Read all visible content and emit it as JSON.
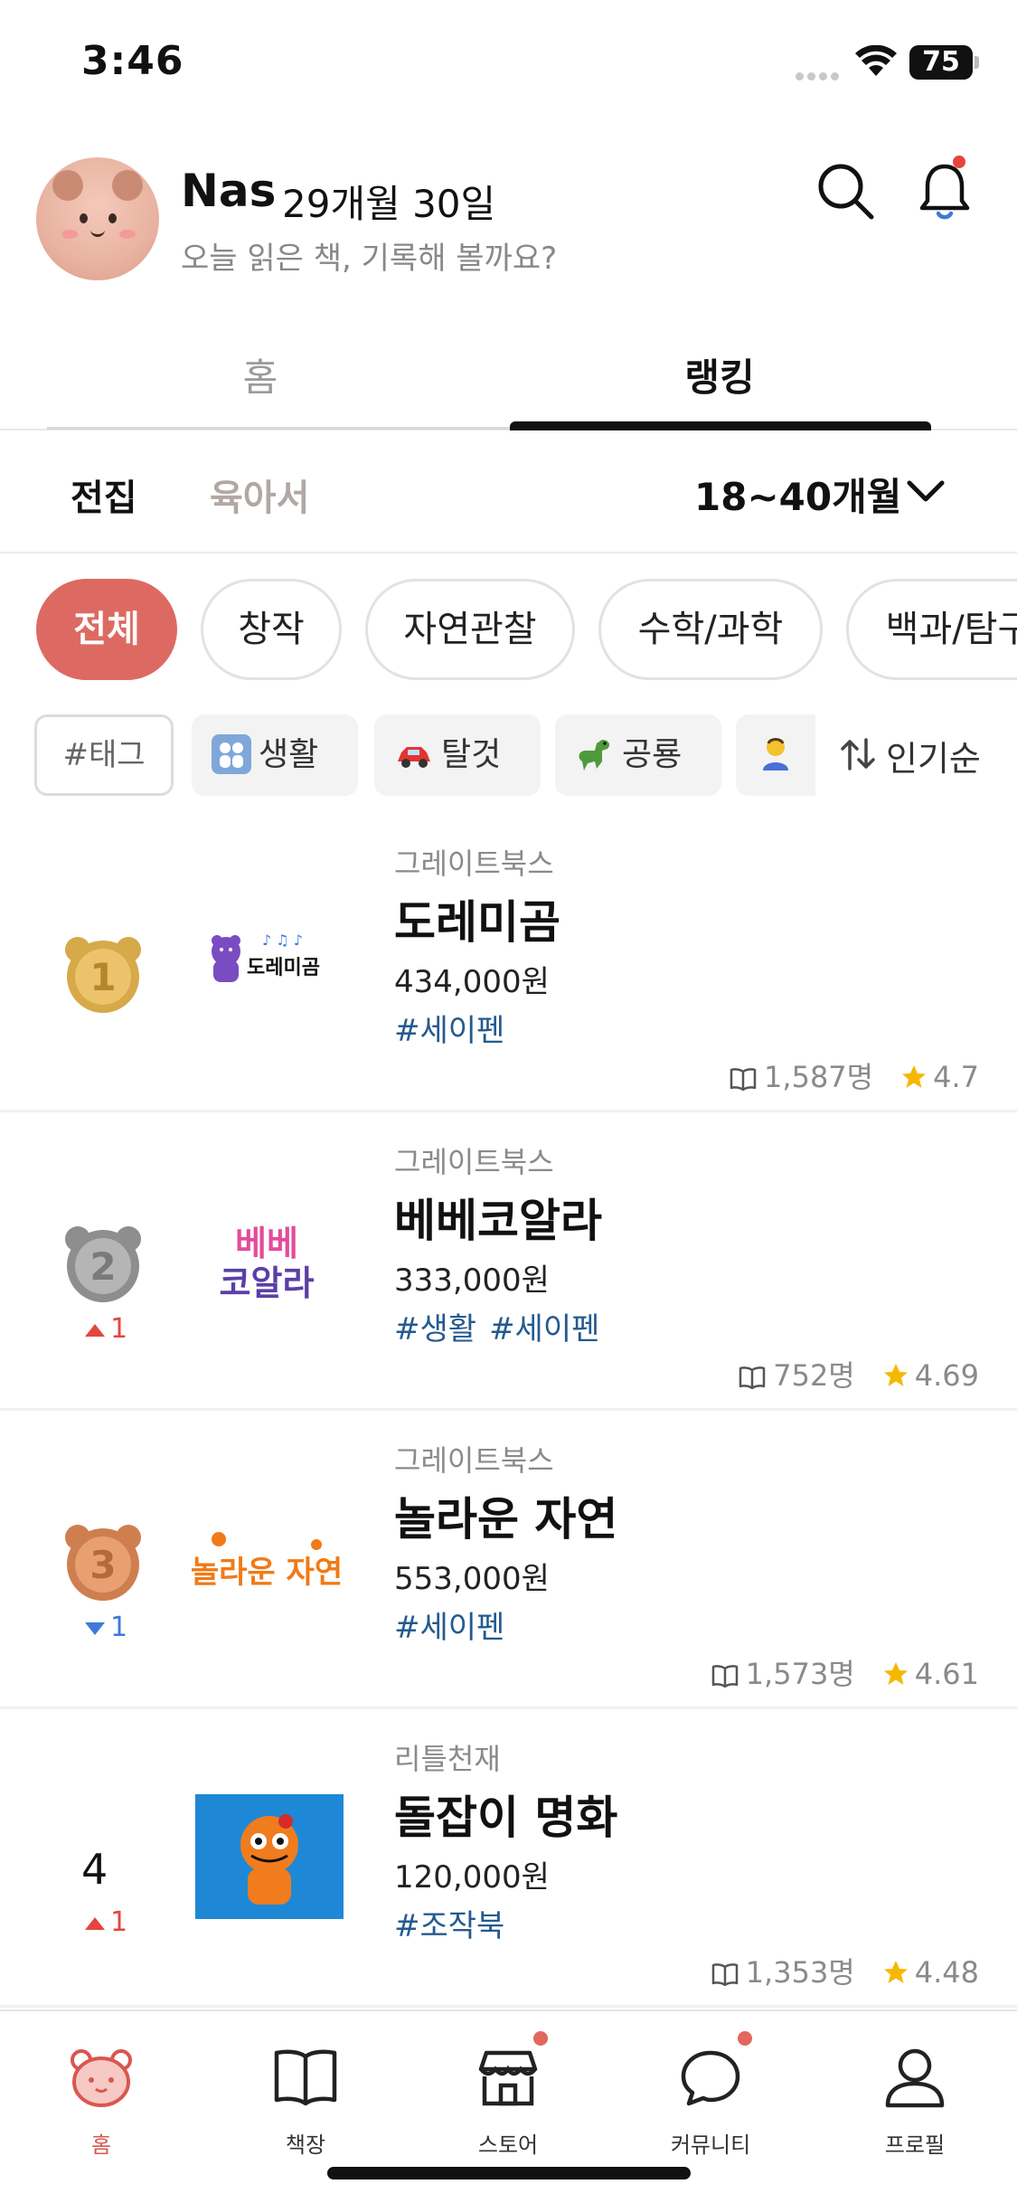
{
  "status_bar": {
    "time": "3:46",
    "battery": "75"
  },
  "header": {
    "user_name": "Nas",
    "child_age": "29개월 30일",
    "subtitle": "오늘 읽은 책, 기록해 볼까요?"
  },
  "main_tabs": {
    "home": "홈",
    "ranking": "랭킹",
    "active": "ranking"
  },
  "sub_tabs": {
    "all": "전집",
    "parenting": "육아서",
    "age_filter": "18~40개월"
  },
  "categories": [
    "전체",
    "창작",
    "자연관찰",
    "수학/과학",
    "백과/탐구"
  ],
  "tags": {
    "input_label": "#태그",
    "items": [
      {
        "label": "생활",
        "icon": "family-emoji-icon"
      },
      {
        "label": "탈것",
        "icon": "car-emoji-icon"
      },
      {
        "label": "공룡",
        "icon": "dinosaur-emoji-icon"
      },
      {
        "label": "",
        "icon": "person-bowing-emoji-icon"
      }
    ],
    "sort_label": "인기순"
  },
  "rankings": [
    {
      "rank": "1",
      "medal": "gold",
      "change": "",
      "change_dir": "",
      "publisher": "그레이트북스",
      "title": "도레미곰",
      "price": "434,000원",
      "tags": [
        "#세이펜"
      ],
      "readers": "1,587명",
      "rating": "4.7",
      "logo_text": "도레미곰"
    },
    {
      "rank": "2",
      "medal": "silver",
      "change": "1",
      "change_dir": "up",
      "publisher": "그레이트북스",
      "title": "베베코알라",
      "price": "333,000원",
      "tags": [
        "#생활",
        "#세이펜"
      ],
      "readers": "752명",
      "rating": "4.69",
      "logo_text_1": "베베",
      "logo_text_2": "코알라"
    },
    {
      "rank": "3",
      "medal": "bronze",
      "change": "1",
      "change_dir": "down",
      "publisher": "그레이트북스",
      "title": "놀라운 자연",
      "price": "553,000원",
      "tags": [
        "#세이펜"
      ],
      "readers": "1,573명",
      "rating": "4.61",
      "logo_text": "놀라운 자연"
    },
    {
      "rank": "4",
      "medal": "",
      "change": "1",
      "change_dir": "up",
      "publisher": "리틀천재",
      "title": "돌잡이 명화",
      "price": "120,000원",
      "tags": [
        "#조작북"
      ],
      "readers": "1,353명",
      "rating": "4.48"
    }
  ],
  "bottom_nav": [
    {
      "label": "홈",
      "icon": "bear-home-icon",
      "active": true
    },
    {
      "label": "책장",
      "icon": "open-book-icon",
      "active": false
    },
    {
      "label": "스토어",
      "icon": "store-icon",
      "active": false,
      "dot": true
    },
    {
      "label": "커뮤니티",
      "icon": "chat-bubble-icon",
      "active": false,
      "dot": true
    },
    {
      "label": "프로필",
      "icon": "person-icon",
      "active": false
    }
  ],
  "colors": {
    "accent": "#dd6a62",
    "hashtag": "#245a8f",
    "up": "#e5453f",
    "down": "#3e7bd6",
    "star": "#f5b800"
  }
}
